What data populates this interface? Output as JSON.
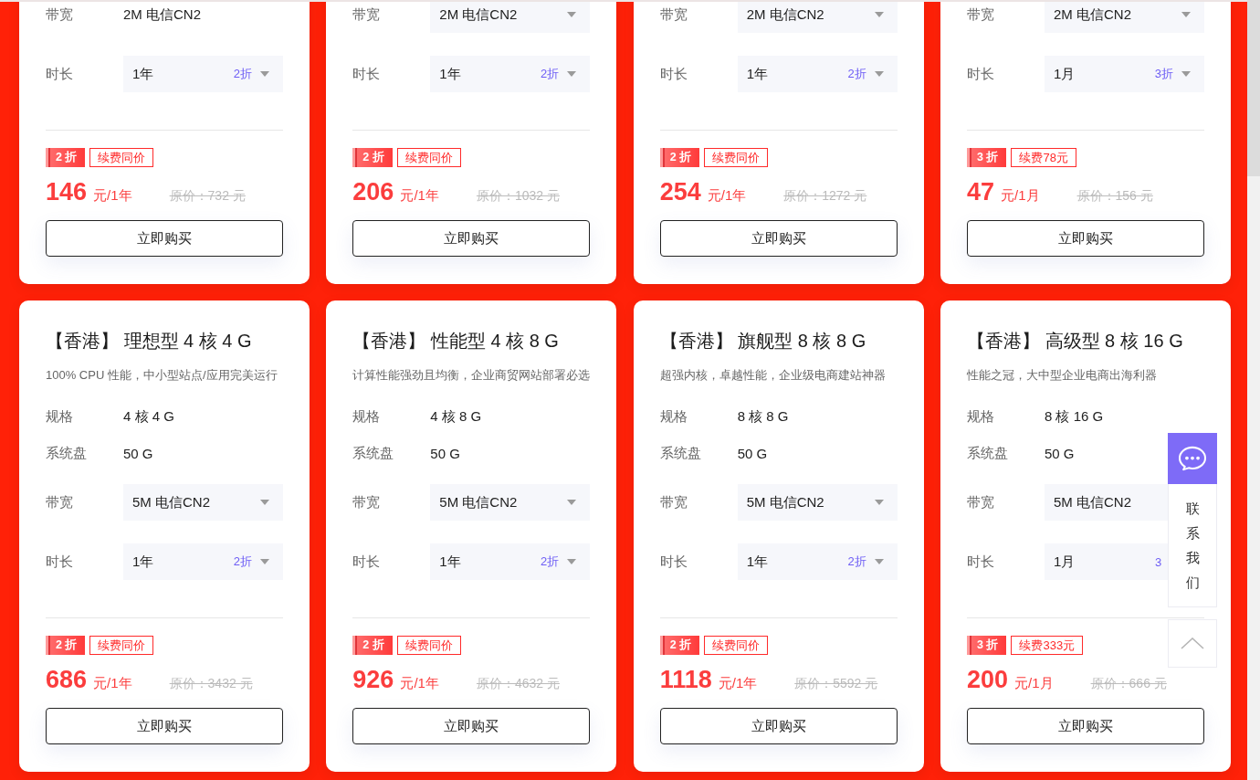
{
  "top_row": [
    {
      "options": [
        {
          "label": "带宽",
          "kind": "text",
          "value": "2M 电信CN2"
        },
        {
          "label": "时长",
          "kind": "select",
          "value": "1年",
          "discount": "2折"
        }
      ],
      "badge": "2 折",
      "renew": "续费同价",
      "price": "146",
      "unit": "元/1年",
      "original_price": "原价：732 元",
      "button": "立即购买"
    },
    {
      "options": [
        {
          "label": "带宽",
          "kind": "select",
          "value": "2M 电信CN2"
        },
        {
          "label": "时长",
          "kind": "select",
          "value": "1年",
          "discount": "2折"
        }
      ],
      "badge": "2 折",
      "renew": "续费同价",
      "price": "206",
      "unit": "元/1年",
      "original_price": "原价：1032 元",
      "button": "立即购买"
    },
    {
      "options": [
        {
          "label": "带宽",
          "kind": "select",
          "value": "2M 电信CN2"
        },
        {
          "label": "时长",
          "kind": "select",
          "value": "1年",
          "discount": "2折"
        }
      ],
      "badge": "2 折",
      "renew": "续费同价",
      "price": "254",
      "unit": "元/1年",
      "original_price": "原价：1272 元",
      "button": "立即购买"
    },
    {
      "options": [
        {
          "label": "带宽",
          "kind": "select",
          "value": "2M 电信CN2"
        },
        {
          "label": "时长",
          "kind": "select",
          "value": "1月",
          "discount": "3折"
        }
      ],
      "badge": "3 折",
      "renew": "续费78元",
      "price": "47",
      "unit": "元/1月",
      "original_price": "原价：156 元",
      "button": "立即购买"
    }
  ],
  "bottom_row": [
    {
      "title": "【香港】 理想型 4 核 4 G",
      "description": "100% CPU 性能，中小型站点/应用完美运行",
      "specs": [
        {
          "label": "规格",
          "value": "4 核 4 G"
        },
        {
          "label": "系统盘",
          "value": "50 G"
        }
      ],
      "options": [
        {
          "label": "带宽",
          "kind": "select",
          "value": "5M 电信CN2"
        },
        {
          "label": "时长",
          "kind": "select",
          "value": "1年",
          "discount": "2折"
        }
      ],
      "badge": "2 折",
      "renew": "续费同价",
      "price": "686",
      "unit": "元/1年",
      "original_price": "原价：3432 元",
      "button": "立即购买"
    },
    {
      "title": "【香港】 性能型 4 核 8 G",
      "description": "计算性能强劲且均衡，企业商贸网站部署必选",
      "specs": [
        {
          "label": "规格",
          "value": "4 核 8 G"
        },
        {
          "label": "系统盘",
          "value": "50 G"
        }
      ],
      "options": [
        {
          "label": "带宽",
          "kind": "select",
          "value": "5M 电信CN2"
        },
        {
          "label": "时长",
          "kind": "select",
          "value": "1年",
          "discount": "2折"
        }
      ],
      "badge": "2 折",
      "renew": "续费同价",
      "price": "926",
      "unit": "元/1年",
      "original_price": "原价：4632 元",
      "button": "立即购买"
    },
    {
      "title": "【香港】 旗舰型 8 核 8 G",
      "description": "超强内核，卓越性能，企业级电商建站神器",
      "specs": [
        {
          "label": "规格",
          "value": "8 核 8 G"
        },
        {
          "label": "系统盘",
          "value": "50 G"
        }
      ],
      "options": [
        {
          "label": "带宽",
          "kind": "select",
          "value": "5M 电信CN2"
        },
        {
          "label": "时长",
          "kind": "select",
          "value": "1年",
          "discount": "2折"
        }
      ],
      "badge": "2 折",
      "renew": "续费同价",
      "price": "1118",
      "unit": "元/1年",
      "original_price": "原价：5592 元",
      "button": "立即购买"
    },
    {
      "title": "【香港】 高级型 8 核 16 G",
      "description": "性能之冠，大中型企业电商出海利器",
      "specs": [
        {
          "label": "规格",
          "value": "8 核 16 G"
        },
        {
          "label": "系统盘",
          "value": "50 G"
        }
      ],
      "options": [
        {
          "label": "带宽",
          "kind": "select",
          "value": "5M 电信CN2"
        },
        {
          "label": "时长",
          "kind": "select",
          "value": "1月",
          "discount": "3"
        }
      ],
      "badge": "3 折",
      "renew": "续费333元",
      "price": "200",
      "unit": "元/1月",
      "original_price": "原价：666 元",
      "button": "立即购买"
    }
  ],
  "float_widget": {
    "contact_label": "联系我们"
  }
}
